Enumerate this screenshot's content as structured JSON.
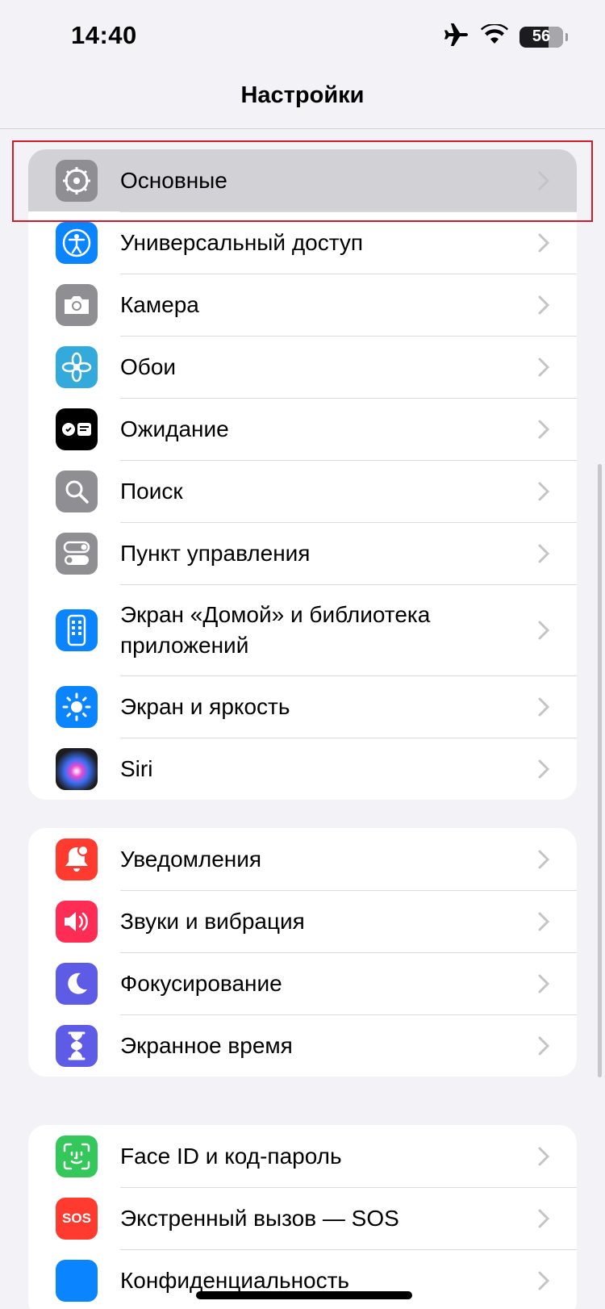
{
  "status_bar": {
    "time": "14:40",
    "battery": "56"
  },
  "nav": {
    "title": "Настройки"
  },
  "groups": [
    {
      "items": [
        {
          "label": "Основные",
          "icon": "gear-icon",
          "color": "#8e8e93"
        },
        {
          "label": "Универсальный доступ",
          "icon": "accessibility-icon",
          "color": "#0a84ff"
        },
        {
          "label": "Камера",
          "icon": "camera-icon",
          "color": "#8e8e93"
        },
        {
          "label": "Обои",
          "icon": "wallpaper-flower-icon",
          "color": "#34aadc"
        },
        {
          "label": "Ожидание",
          "icon": "standby-icon",
          "color": "#000000"
        },
        {
          "label": "Поиск",
          "icon": "search-icon",
          "color": "#8e8e93"
        },
        {
          "label": "Пункт управления",
          "icon": "control-center-icon",
          "color": "#8e8e93"
        },
        {
          "label": "Экран «Домой» и библиотека приложений",
          "icon": "home-screen-icon",
          "color": "#0a84ff"
        },
        {
          "label": "Экран и яркость",
          "icon": "brightness-icon",
          "color": "#0a84ff"
        },
        {
          "label": "Siri",
          "icon": "siri-icon",
          "color": "#1c1c1e"
        }
      ]
    },
    {
      "items": [
        {
          "label": "Уведомления",
          "icon": "notifications-bell-icon",
          "color": "#ff3b30"
        },
        {
          "label": "Звуки и вибрация",
          "icon": "speaker-icon",
          "color": "#ff2d55"
        },
        {
          "label": "Фокусирование",
          "icon": "moon-icon",
          "color": "#5e5ce6"
        },
        {
          "label": "Экранное время",
          "icon": "hourglass-icon",
          "color": "#5e5ce6"
        }
      ]
    },
    {
      "items": [
        {
          "label": "Face ID и код-пароль",
          "icon": "face-id-icon",
          "color": "#34c759"
        },
        {
          "label": "Экстренный вызов — SOS",
          "icon": "sos-icon",
          "color": "#ff3b30",
          "icon_text": "SOS"
        },
        {
          "label": "Конфиденциальность",
          "icon": "privacy-hand-icon",
          "color": "#0a84ff"
        }
      ]
    }
  ],
  "colors": {
    "highlight_border": "#d11a2a",
    "selected_row": "#d1d1d6",
    "background": "#f2f2f7"
  }
}
